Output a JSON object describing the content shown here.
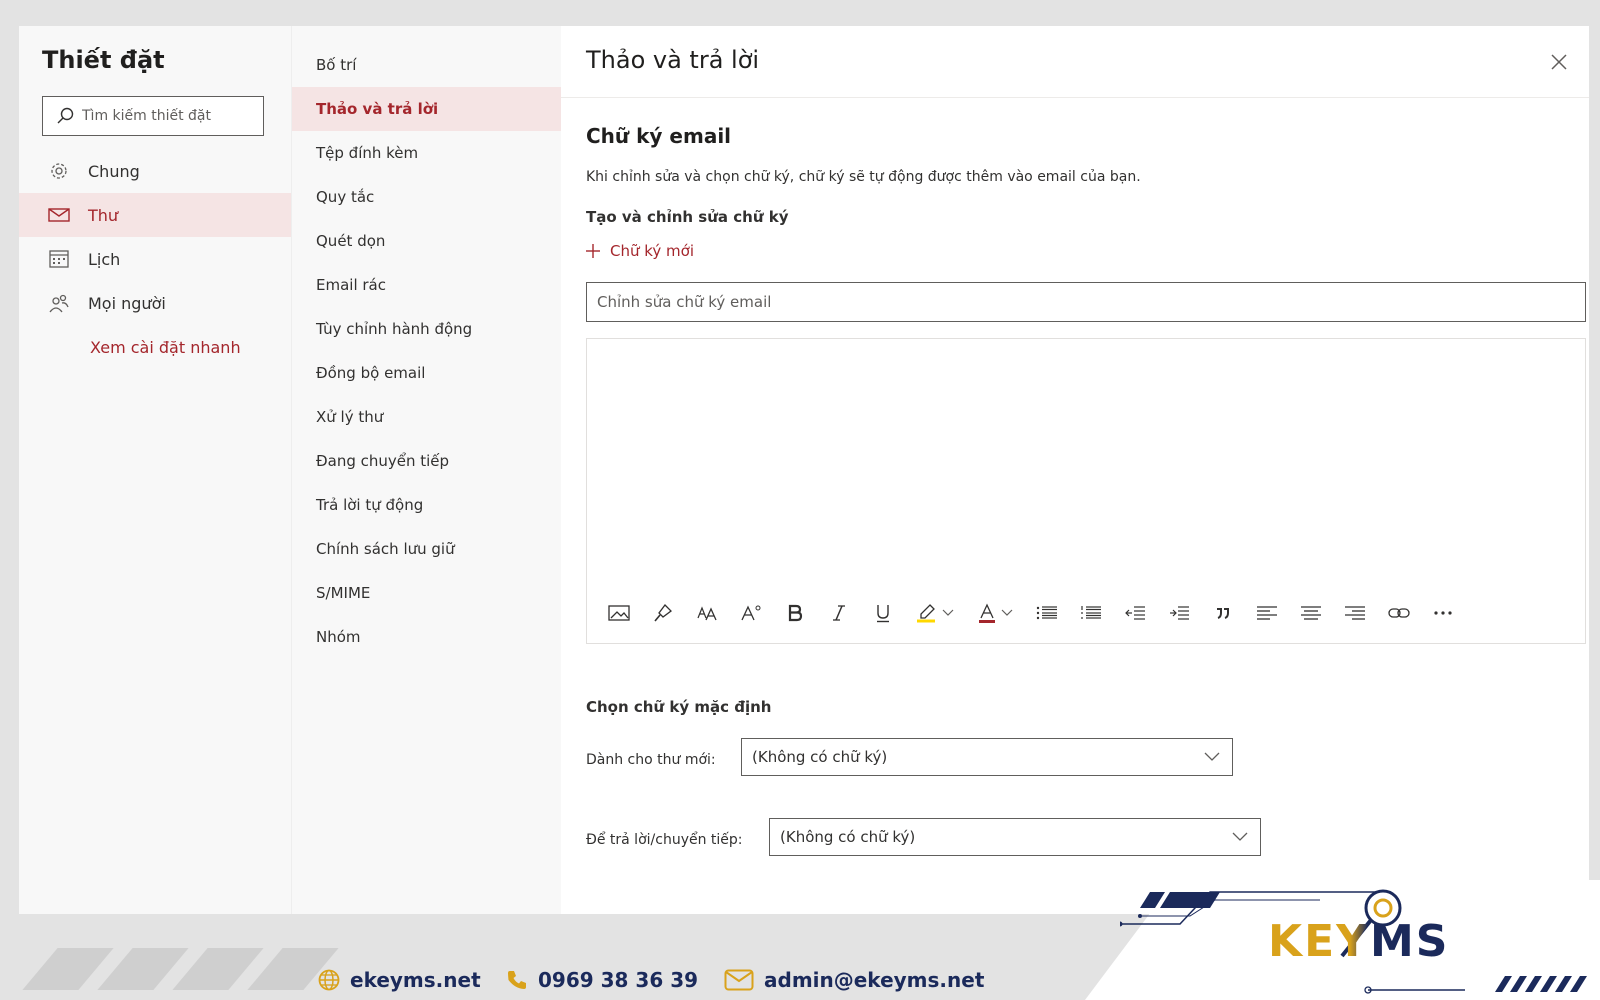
{
  "left": {
    "title": "Thiết đặt",
    "search_placeholder": "Tìm kiếm thiết đặt",
    "items": [
      {
        "label": "Chung",
        "icon": "gear-icon"
      },
      {
        "label": "Thư",
        "icon": "mail-icon"
      },
      {
        "label": "Lịch",
        "icon": "calendar-icon"
      },
      {
        "label": "Mọi người",
        "icon": "people-icon"
      }
    ],
    "quick_settings": "Xem cài đặt nhanh"
  },
  "middle": {
    "items": [
      "Bố trí",
      "Thảo và trả lời",
      "Tệp đính kèm",
      "Quy tắc",
      "Quét dọn",
      "Email rác",
      "Tùy chỉnh hành động",
      "Đồng bộ email",
      "Xử lý thư",
      "Đang chuyển tiếp",
      "Trả lời tự động",
      "Chính sách lưu giữ",
      "S/MIME",
      "Nhóm"
    ]
  },
  "panel": {
    "title": "Thảo và trả lời",
    "section_title": "Chữ ký email",
    "description": "Khi chỉnh sửa và chọn chữ ký, chữ ký sẽ tự động được thêm vào email của bạn.",
    "create_heading": "Tạo và chỉnh sửa chữ ký",
    "new_signature": "Chữ ký mới",
    "signature_name_placeholder": "Chỉnh sửa chữ ký email",
    "default_heading": "Chọn chữ ký mặc định",
    "new_messages_label": "Dành cho thư mới:",
    "new_messages_value": "(Không có chữ ký)",
    "replies_label": "Để trả lời/chuyển tiếp:",
    "replies_value": "(Không có chữ ký)"
  },
  "footer": {
    "website": "ekeyms.net",
    "phone": "0969 38 36 39",
    "email": "admin@ekeyms.net",
    "logo_text": "KEYMS"
  },
  "colors": {
    "accent": "#a4262c",
    "selected_bg": "#f5e4e4",
    "footer_text": "#1b2a5b",
    "logo_gold": "#d9a21b"
  }
}
